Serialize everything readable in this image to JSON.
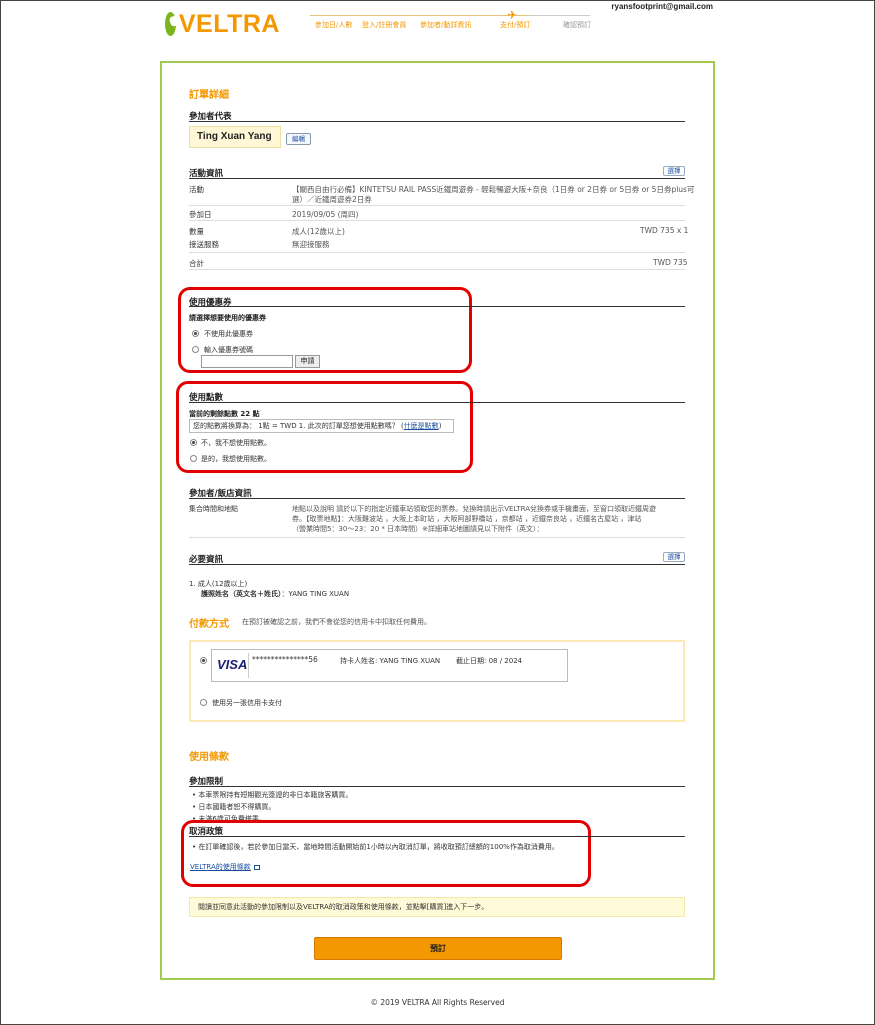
{
  "header": {
    "logo_text": "VELTRA",
    "user_email": "ryansfootprint@gmail.com",
    "steps": [
      "參加日/人數",
      "登入/註冊會員",
      "參加者/動詳資訊",
      "支付/預訂",
      "確認預訂"
    ]
  },
  "order": {
    "title": "訂單詳細",
    "participant_section": "參加者代表",
    "participant_name": "Ting Xuan Yang",
    "edit_label": "編輯",
    "activity_section": "活動資訊",
    "change_label": "選擇",
    "rows": {
      "activity_label": "活動",
      "activity_value_1": "【關西自由行必備】KINTETSU RAIL PASS近鐵周遊券 - 輕鬆暢遊大阪+奈良（1日券 or 2日券 or 5日券 or 5日券plus可",
      "activity_value_2": "選）／近鐵周遊券2日券",
      "date_label": "參加日",
      "date_value": "2019/09/05 (周四)",
      "qty_label": "數量",
      "qty_value": "成人(12歲以上)",
      "qty_price": "TWD 735 x 1",
      "pickup_label": "接送服務",
      "pickup_value": "無迎接服務",
      "total_label": "合計",
      "total_value": "TWD 735"
    }
  },
  "coupon": {
    "title": "使用優惠券",
    "prompt": "請選擇想要使用的優惠券",
    "option_none": "不使用此優惠券",
    "option_code": "輸入優惠券號碼",
    "apply_label": "申請"
  },
  "points": {
    "title": "使用點數",
    "balance": "當前的剩餘點數 22 點",
    "info_text": "您的點數將換算為： 1點 = TWD 1. 此次的訂單您想使用點數嗎？",
    "info_link": "什麼是點數",
    "option_no": "不，我不想使用點數。",
    "option_yes": "是的，我想使用點數。"
  },
  "meeting": {
    "title": "參加者/飯店資訊",
    "label": "集合時間和地點",
    "text_1": "地點以及說明 請於以下的指定近鐵車站領取您的票券。兌換時請出示VELTRA兌換券或手機畫面，至窗口領取近鐵周遊",
    "text_2": "券。【取票地點】：大阪難波站 ，大阪上本町站 ，大阪阿部野橋站 ，京都站 ，近鐵奈良站 ，近鐵名古屋站 ，津站",
    "text_3": "（營業時間5：30～23：20 * 日本時間）※詳細車站地圖請見以下附件（英文）："
  },
  "required": {
    "title": "必要資訊",
    "change_label": "選擇",
    "item_1": "1. 成人(12歲以上)",
    "passport_label": "護照姓名（英文名＋姓氏）",
    "passport_value": "：YANG TING XUAN"
  },
  "payment": {
    "title": "付款方式",
    "note": "在預訂被確認之前，我們不會從您的信用卡中扣取任何費用。",
    "card_brand": "VISA",
    "card_number": "***************56",
    "card_holder": "持卡人姓名: YANG TING XUAN",
    "expiry": "截止日期: 08 / 2024",
    "other_card": "使用另一張信用卡支付"
  },
  "terms": {
    "title": "使用條款",
    "restriction_title": "參加限制",
    "restrictions": [
      "本車票限持有短期觀光簽證的非日本籍旅客購買。",
      "日本國籍者恕不得購買。",
      "未滿6歲可免費搭乘。"
    ],
    "cancel_title": "取消政策",
    "cancel_text": "在訂單確認後，若於參加日當天、當地時間活動開始前1小時以內取消訂單，將收取預訂總額的100%作為取消費用。",
    "veltra_terms_link": "VELTRA的使用條款",
    "agree_notice": "閱讀並同意此活動的參加限制以及VELTRA的取消政策和使用條款，並點擊[購買]進入下一步。",
    "submit_label": "預訂"
  },
  "footer": {
    "copyright": "© 2019 VELTRA All Rights Reserved"
  }
}
